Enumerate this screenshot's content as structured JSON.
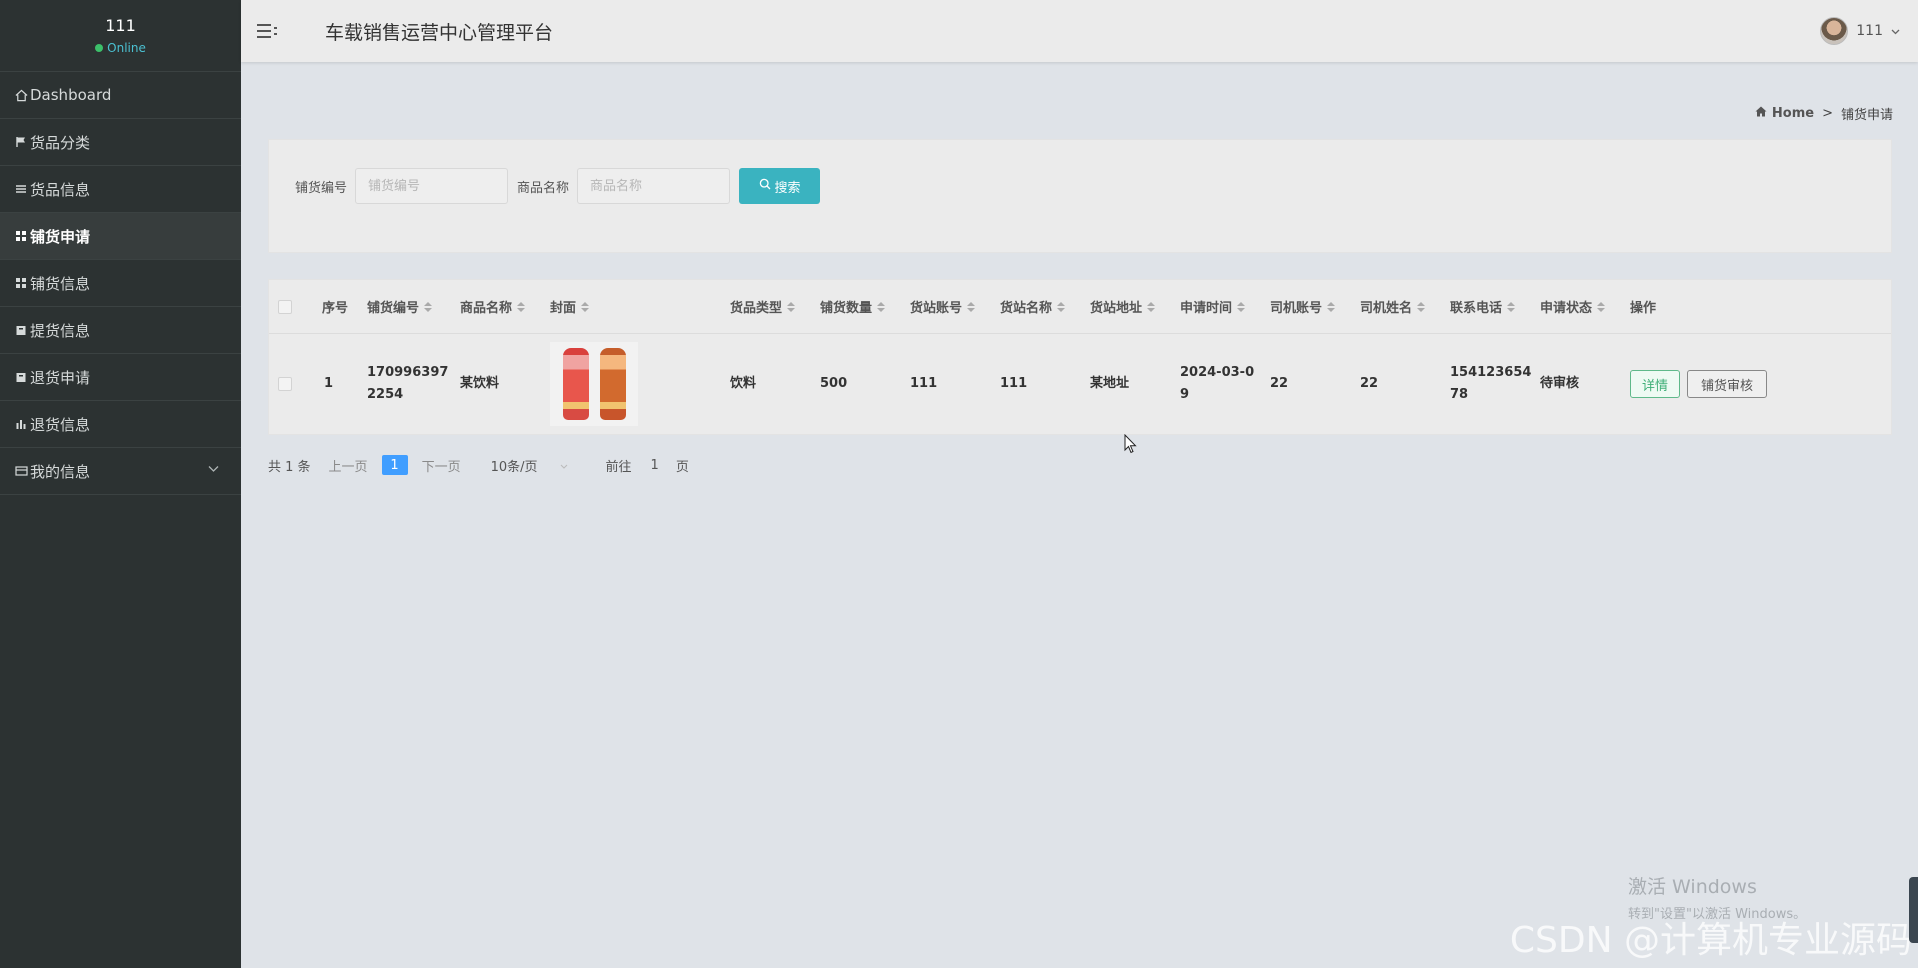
{
  "sidebar": {
    "user_name": "111",
    "user_status": "Online",
    "items": [
      {
        "label": "Dashboard",
        "icon": "home-icon"
      },
      {
        "label": "货品分类",
        "icon": "flag-icon"
      },
      {
        "label": "货品信息",
        "icon": "list-icon"
      },
      {
        "label": "铺货申请",
        "icon": "grid-icon",
        "active": true
      },
      {
        "label": "铺货信息",
        "icon": "grid-icon"
      },
      {
        "label": "提货信息",
        "icon": "box-icon"
      },
      {
        "label": "退货申请",
        "icon": "box-icon"
      },
      {
        "label": "退货信息",
        "icon": "bar-chart-icon"
      },
      {
        "label": "我的信息",
        "icon": "card-icon",
        "expandable": true
      }
    ]
  },
  "header": {
    "title": "车载销售运营中心管理平台",
    "user_label": "111"
  },
  "breadcrumb": {
    "home": "Home",
    "separator": ">",
    "current": "铺货申请"
  },
  "search": {
    "field1_label": "铺货编号",
    "field1_placeholder": "铺货编号",
    "field2_label": "商品名称",
    "field2_placeholder": "商品名称",
    "button_label": "搜索"
  },
  "table": {
    "headers": {
      "index": "序号",
      "code": "铺货编号",
      "name": "商品名称",
      "cover": "封面",
      "type": "货品类型",
      "qty": "铺货数量",
      "station_acct": "货站账号",
      "station_name": "货站名称",
      "station_addr": "货站地址",
      "apply_time": "申请时间",
      "driver_acct": "司机账号",
      "driver_name": "司机姓名",
      "phone": "联系电话",
      "status": "申请状态",
      "actions": "操作"
    },
    "rows": [
      {
        "index": "1",
        "code_l1": "170996397",
        "code_l2": "2254",
        "name": "某饮料",
        "type": "饮料",
        "qty": "500",
        "station_acct": "111",
        "station_name": "111",
        "station_addr": "某地址",
        "apply_time_l1": "2024-03-0",
        "apply_time_l2": "9",
        "driver_acct": "22",
        "driver_name": "22",
        "phone_l1": "154123654",
        "phone_l2": "78",
        "status": "待审核",
        "detail_label": "详情",
        "audit_label": "铺货审核"
      }
    ]
  },
  "pagination": {
    "total": "共 1 条",
    "prev": "上一页",
    "current": "1",
    "next": "下一页",
    "page_size": "10条/页",
    "goto_label": "前往",
    "goto_value": "1",
    "page_suffix": "页"
  },
  "watermarks": {
    "windows_l1": "激活 Windows",
    "windows_l2": "转到\"设置\"以激活 Windows。",
    "csdn": "CSDN @计算机专业源码"
  },
  "colors": {
    "sidebar_bg": "#2c3232",
    "accent": "#3ab3c0",
    "page_active": "#409eff",
    "detail_green": "#3fae77",
    "online": "#3cc06a"
  }
}
